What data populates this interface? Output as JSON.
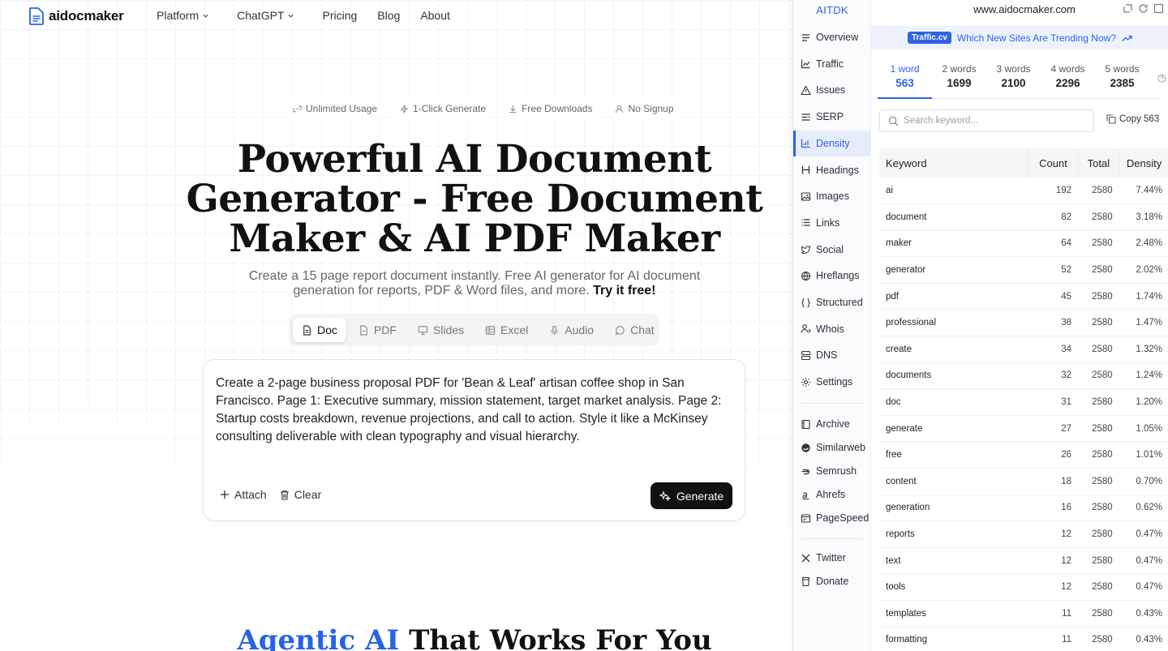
{
  "site": {
    "logo": "aidocmaker",
    "nav": [
      {
        "label": "Platform",
        "dropdown": true
      },
      {
        "label": "ChatGPT",
        "dropdown": true
      },
      {
        "label": "Pricing",
        "dropdown": false
      },
      {
        "label": "Blog",
        "dropdown": false
      },
      {
        "label": "About",
        "dropdown": false
      }
    ],
    "chips": [
      "Unlimited Usage",
      "1-Click Generate",
      "Free Downloads",
      "No Signup"
    ],
    "hero_title": "Powerful AI Document Generator - Free Document Maker & AI PDF Maker",
    "hero_sub": "Create a 15 page report document instantly. Free AI generator for AI document generation for reports, PDF & Word files, and more.",
    "hero_sub_bold": "Try it free!",
    "modes": [
      {
        "label": "Doc",
        "icon": "doc-icon",
        "active": true
      },
      {
        "label": "PDF",
        "icon": "pdf-icon",
        "active": false
      },
      {
        "label": "Slides",
        "icon": "slides-icon",
        "active": false
      },
      {
        "label": "Excel",
        "icon": "excel-icon",
        "active": false
      },
      {
        "label": "Audio",
        "icon": "mic-icon",
        "active": false
      },
      {
        "label": "Chat",
        "icon": "chat-icon",
        "active": false
      }
    ],
    "prompt": "Create a 2-page business proposal PDF for 'Bean & Leaf' artisan coffee shop in San Francisco. Page 1: Executive summary, mission statement, target market analysis. Page 2: Startup costs breakdown, revenue projections, and call to action. Style it like a McKinsey consulting deliverable with clean typography and visual hierarchy.",
    "attach_label": "Attach",
    "clear_label": "Clear",
    "generate_label": "Generate",
    "section_title_accent": "Agentic AI",
    "section_title_rest": " That Works For You"
  },
  "ext": {
    "brand": "AITDK",
    "domain": "www.aidocmaker.com",
    "promo_tag": "Traffic.cv",
    "promo_text": "Which New Sites Are Trending Now?",
    "sidebar": [
      {
        "label": "Overview",
        "icon": "overview-icon"
      },
      {
        "label": "Traffic",
        "icon": "traffic-icon"
      },
      {
        "label": "Issues",
        "icon": "warning-icon"
      },
      {
        "label": "SERP",
        "icon": "serp-icon"
      },
      {
        "label": "Density",
        "icon": "density-icon",
        "active": true
      },
      {
        "label": "Headings",
        "icon": "heading-icon"
      },
      {
        "label": "Images",
        "icon": "image-icon"
      },
      {
        "label": "Links",
        "icon": "links-icon"
      },
      {
        "label": "Social",
        "icon": "social-icon"
      },
      {
        "label": "Hreflangs",
        "icon": "globe-icon"
      },
      {
        "label": "Structured",
        "icon": "braces-icon"
      },
      {
        "label": "Whois",
        "icon": "user-icon"
      },
      {
        "label": "DNS",
        "icon": "server-icon"
      },
      {
        "label": "Settings",
        "icon": "gear-icon"
      }
    ],
    "tools": [
      {
        "label": "Archive",
        "icon": "archive-icon"
      },
      {
        "label": "Similarweb",
        "icon": "similarweb-icon"
      },
      {
        "label": "Semrush",
        "icon": "semrush-icon"
      },
      {
        "label": "Ahrefs",
        "icon": "ahrefs-icon"
      },
      {
        "label": "PageSpeed",
        "icon": "pagespeed-icon"
      }
    ],
    "social": [
      {
        "label": "Twitter",
        "icon": "x-icon"
      },
      {
        "label": "Donate",
        "icon": "cup-icon"
      }
    ],
    "word_tabs": [
      {
        "label": "1 word",
        "count": "563",
        "active": true
      },
      {
        "label": "2 words",
        "count": "1699"
      },
      {
        "label": "3 words",
        "count": "2100"
      },
      {
        "label": "4 words",
        "count": "2296"
      },
      {
        "label": "5 words",
        "count": "2385"
      }
    ],
    "search_placeholder": "Search keyword...",
    "copy_label": "Copy 563",
    "table_headers": [
      "Keyword",
      "Count",
      "Total",
      "Density"
    ],
    "rows": [
      [
        "ai",
        "192",
        "2580",
        "7.44%"
      ],
      [
        "document",
        "82",
        "2580",
        "3.18%"
      ],
      [
        "maker",
        "64",
        "2580",
        "2.48%"
      ],
      [
        "generator",
        "52",
        "2580",
        "2.02%"
      ],
      [
        "pdf",
        "45",
        "2580",
        "1.74%"
      ],
      [
        "professional",
        "38",
        "2580",
        "1.47%"
      ],
      [
        "create",
        "34",
        "2580",
        "1.32%"
      ],
      [
        "documents",
        "32",
        "2580",
        "1.24%"
      ],
      [
        "doc",
        "31",
        "2580",
        "1.20%"
      ],
      [
        "generate",
        "27",
        "2580",
        "1.05%"
      ],
      [
        "free",
        "26",
        "2580",
        "1.01%"
      ],
      [
        "content",
        "18",
        "2580",
        "0.70%"
      ],
      [
        "generation",
        "16",
        "2580",
        "0.62%"
      ],
      [
        "reports",
        "12",
        "2580",
        "0.47%"
      ],
      [
        "text",
        "12",
        "2580",
        "0.47%"
      ],
      [
        "tools",
        "12",
        "2580",
        "0.47%"
      ],
      [
        "templates",
        "11",
        "2580",
        "0.43%"
      ],
      [
        "formatting",
        "11",
        "2580",
        "0.43%"
      ]
    ]
  }
}
